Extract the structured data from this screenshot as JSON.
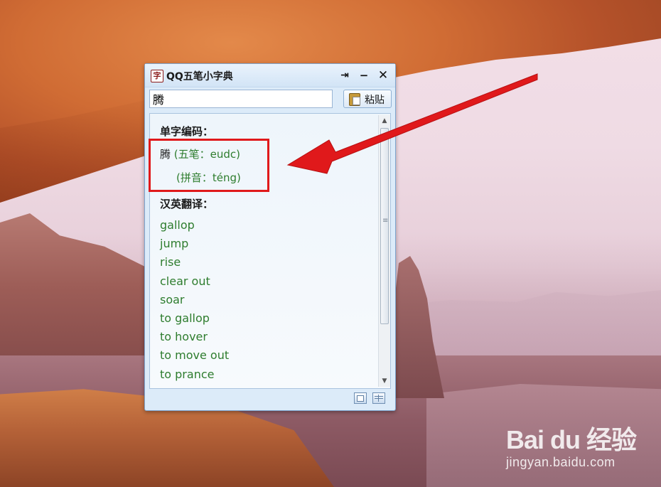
{
  "window": {
    "title": "QQ五笔小字典",
    "app_icon_glyph": "字",
    "pin_glyph": "⇥",
    "minimize_glyph": "−",
    "close_glyph": "✕"
  },
  "search": {
    "value": "腾"
  },
  "paste_button": {
    "label": "粘贴"
  },
  "result": {
    "code_section_title": "单字编码：",
    "character": "腾",
    "wubi_line": "(五笔：eudc)",
    "pinyin_line": "(拼音：téng)",
    "translation_section_title": "汉英翻译：",
    "translations": [
      "gallop",
      "jump",
      "rise",
      "clear out",
      "soar",
      "to gallop",
      "to hover",
      "to move out",
      "to prance"
    ]
  },
  "scrollbar": {
    "up_glyph": "▲",
    "down_glyph": "▼",
    "grip_glyph": "≡"
  },
  "watermark": {
    "logo": "Bai du 经验",
    "url": "jingyan.baidu.com"
  },
  "colors": {
    "highlight_red": "#e0191b",
    "translation_green": "#2e7d2e",
    "window_blue": "#dcebf9"
  }
}
